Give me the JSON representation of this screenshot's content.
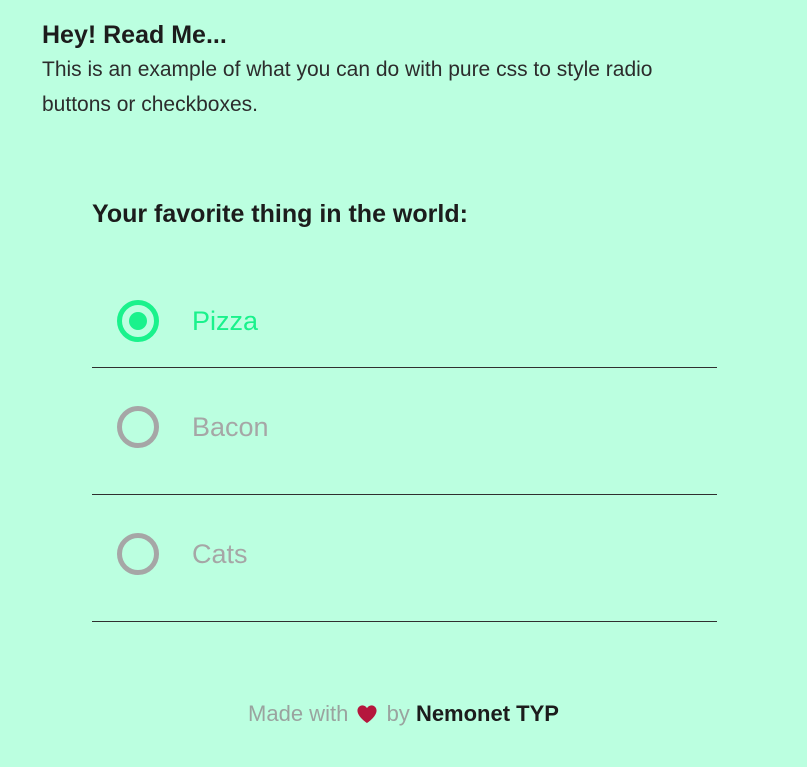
{
  "readme": {
    "title": "Hey! Read Me...",
    "text": "This is an example of what you can do with pure css to style radio buttons or checkboxes."
  },
  "form": {
    "title": "Your favorite thing in the world:",
    "options": [
      {
        "label": "Pizza",
        "selected": true
      },
      {
        "label": "Bacon",
        "selected": false
      },
      {
        "label": "Cats",
        "selected": false
      }
    ]
  },
  "footer": {
    "made_with": "Made with",
    "heart_icon": "heart-icon",
    "by": "by",
    "author": "Nemonet TYP"
  },
  "colors": {
    "background": "#bbffe0",
    "accent": "#1af28c",
    "muted": "#a6a6a6",
    "heart": "#b5173d"
  }
}
